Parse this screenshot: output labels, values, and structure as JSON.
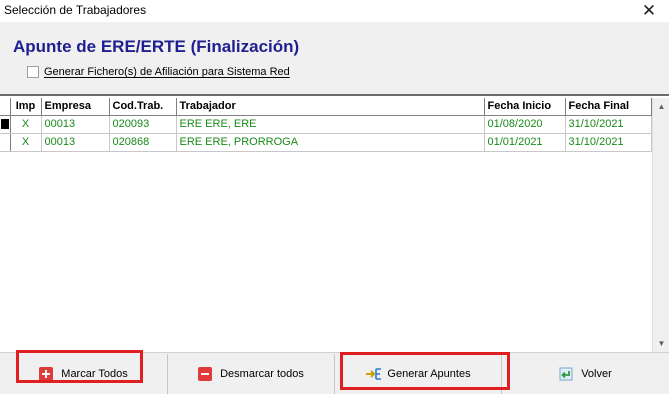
{
  "window": {
    "title": "Selección de Trabajadores",
    "close_glyph": "✕"
  },
  "header": {
    "heading": "Apunte de ERE/ERTE (Finalización)",
    "checkbox_label": "Generar Fichero(s) de Afiliación para Sistema Red",
    "checkbox_checked": false
  },
  "grid": {
    "columns": [
      "Imp",
      "Empresa",
      "Cod.Trab.",
      "Trabajador",
      "Fecha Inicio",
      "Fecha Final"
    ],
    "rows": [
      {
        "imp": "X",
        "empresa": "00013",
        "cod": "020093",
        "trabajador": "ERE ERE, ERE",
        "fecha_inicio": "01/08/2020",
        "fecha_final": "31/10/2021"
      },
      {
        "imp": "X",
        "empresa": "00013",
        "cod": "020868",
        "trabajador": "ERE ERE, PRORROGA",
        "fecha_inicio": "01/01/2021",
        "fecha_final": "31/10/2021"
      }
    ]
  },
  "footer": {
    "marcar_todos": "Marcar Todos",
    "desmarcar_todos": "Desmarcar todos",
    "generar_apuntes": "Generar Apuntes",
    "volver": "Volver"
  },
  "colors": {
    "heading": "#1f1f8f",
    "row_text": "#1a8a1a",
    "highlight": "#e02020"
  },
  "icons": {
    "marcar_todos": "red-plus-icon",
    "desmarcar_todos": "red-minus-icon",
    "generar_apuntes": "generate-entries-icon",
    "volver": "back-arrow-icon"
  }
}
